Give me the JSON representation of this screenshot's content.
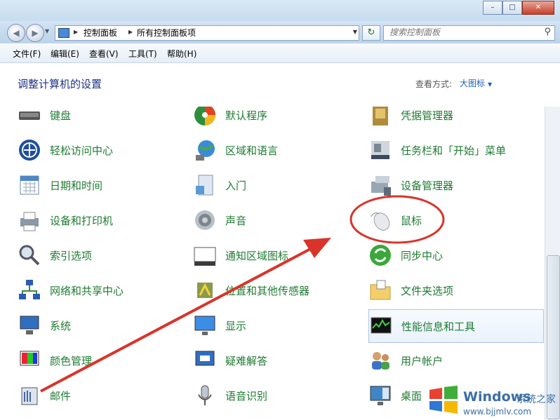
{
  "window": {
    "minimize_glyph": "–",
    "maximize_glyph": "□",
    "close_glyph": "✕"
  },
  "nav": {
    "back_glyph": "◀",
    "forward_glyph": "▶",
    "breadcrumb": [
      "控制面板",
      "所有控制面板项"
    ],
    "refresh_glyph": "↻",
    "search_placeholder": "搜索控制面板"
  },
  "menubar": {
    "items": [
      "文件(F)",
      "编辑(E)",
      "查看(V)",
      "工具(T)",
      "帮助(H)"
    ]
  },
  "header": {
    "title": "调整计算机的设置",
    "view_by_label": "查看方式:",
    "view_by_value": "大图标"
  },
  "items": [
    {
      "label": "键盘",
      "icon": "keyboard-icon"
    },
    {
      "label": "默认程序",
      "icon": "default-programs-icon"
    },
    {
      "label": "凭据管理器",
      "icon": "credential-manager-icon"
    },
    {
      "label": "轻松访问中心",
      "icon": "ease-of-access-icon"
    },
    {
      "label": "区域和语言",
      "icon": "region-language-icon"
    },
    {
      "label": "任务栏和「开始」菜单",
      "icon": "taskbar-start-menu-icon"
    },
    {
      "label": "日期和时间",
      "icon": "date-time-icon"
    },
    {
      "label": "入门",
      "icon": "getting-started-icon"
    },
    {
      "label": "设备管理器",
      "icon": "device-manager-icon"
    },
    {
      "label": "设备和打印机",
      "icon": "devices-printers-icon"
    },
    {
      "label": "声音",
      "icon": "sound-icon"
    },
    {
      "label": "鼠标",
      "icon": "mouse-icon"
    },
    {
      "label": "索引选项",
      "icon": "indexing-options-icon"
    },
    {
      "label": "通知区域图标",
      "icon": "notification-area-icon"
    },
    {
      "label": "同步中心",
      "icon": "sync-center-icon"
    },
    {
      "label": "网络和共享中心",
      "icon": "network-sharing-icon"
    },
    {
      "label": "位置和其他传感器",
      "icon": "location-sensors-icon"
    },
    {
      "label": "文件夹选项",
      "icon": "folder-options-icon"
    },
    {
      "label": "系统",
      "icon": "system-icon"
    },
    {
      "label": "显示",
      "icon": "display-icon"
    },
    {
      "label": "性能信息和工具",
      "icon": "performance-icon"
    },
    {
      "label": "颜色管理",
      "icon": "color-management-icon"
    },
    {
      "label": "疑难解答",
      "icon": "troubleshooting-icon"
    },
    {
      "label": "用户帐户",
      "icon": "user-accounts-icon"
    },
    {
      "label": "邮件",
      "icon": "mail-icon"
    },
    {
      "label": "语音识别",
      "icon": "speech-recognition-icon"
    },
    {
      "label": "桌面",
      "icon": "desktop-gadgets-icon"
    }
  ],
  "selected_item": "性能信息和工具",
  "highlighted_item": "鼠标",
  "annotation_color": "#d9342b",
  "watermark": {
    "brand": "Windows",
    "brand_suffix": "系统之家",
    "url": "www.bjjmlv.com"
  }
}
